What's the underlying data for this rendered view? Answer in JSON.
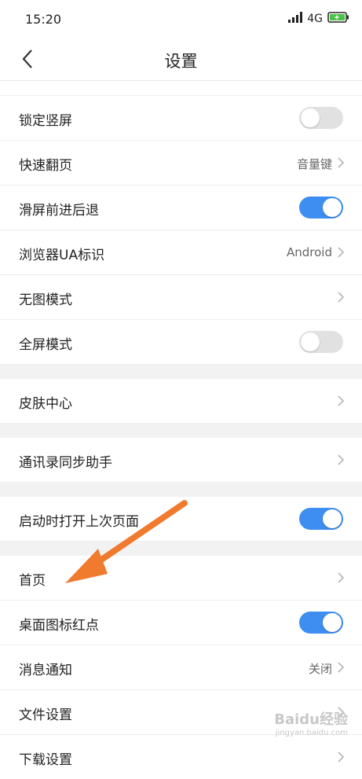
{
  "status": {
    "time": "15:20",
    "network": "4G"
  },
  "nav": {
    "title": "设置"
  },
  "colors": {
    "accent": "#3d8ef0",
    "toggle_off": "#e1e1e1",
    "arrow": "#f07a2e"
  },
  "rows": [
    {
      "label": "锁定竖屏",
      "type": "toggle",
      "on": false
    },
    {
      "label": "快速翻页",
      "type": "link",
      "value": "音量键"
    },
    {
      "label": "滑屏前进后退",
      "type": "toggle",
      "on": true
    },
    {
      "label": "浏览器UA标识",
      "type": "link",
      "value": "Android"
    },
    {
      "label": "无图模式",
      "type": "link",
      "value": ""
    },
    {
      "label": "全屏模式",
      "type": "toggle",
      "on": false
    },
    {
      "label": "皮肤中心",
      "type": "link",
      "value": ""
    },
    {
      "label": "通讯录同步助手",
      "type": "link",
      "value": ""
    },
    {
      "label": "启动时打开上次页面",
      "type": "toggle",
      "on": true
    },
    {
      "label": "首页",
      "type": "link",
      "value": ""
    },
    {
      "label": "桌面图标红点",
      "type": "toggle",
      "on": true
    },
    {
      "label": "消息通知",
      "type": "link",
      "value": "关闭"
    },
    {
      "label": "文件设置",
      "type": "link",
      "value": ""
    },
    {
      "label": "下载设置",
      "type": "link",
      "value": ""
    }
  ],
  "watermark": {
    "text": "Baidu经验",
    "sub": "jingyan.baidu.com"
  }
}
